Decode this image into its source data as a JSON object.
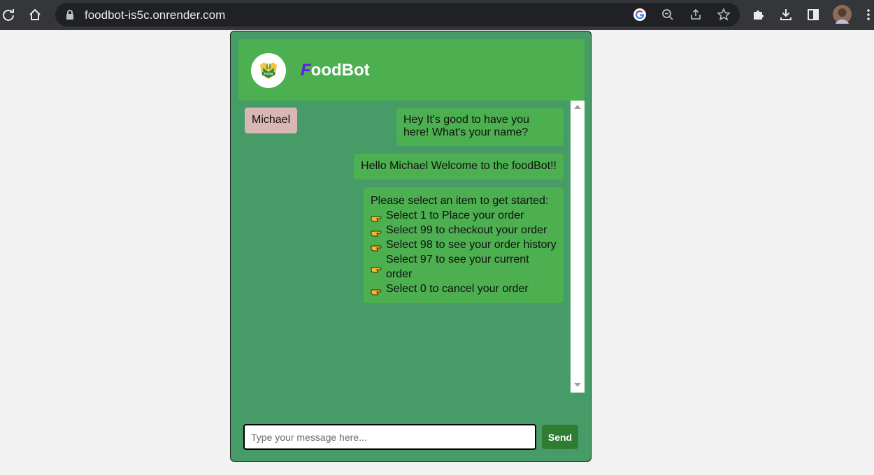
{
  "browser": {
    "url": "foodbot-is5c.onrender.com"
  },
  "chat": {
    "brand_first": "F",
    "brand_rest": "oodBot",
    "messages": {
      "user_name": "Michael",
      "bot_greeting": "Hey It's good to have you here! What's your name?",
      "bot_welcome": "Hello Michael Welcome to the foodBot!!",
      "menu_intro": "Please select an item to get started:",
      "menu_options": [
        "Select 1 to Place your order",
        "Select 99 to checkout your order",
        "Select 98 to see your order history",
        "Select 97 to see your current order",
        "Select 0 to cancel your order"
      ]
    },
    "input_placeholder": "Type your message here...",
    "send_label": "Send"
  },
  "colors": {
    "page_bg": "#f2f2f2",
    "chat_bg": "#479b66",
    "header_bg": "#4caf50",
    "bot_bubble": "#4caf50",
    "user_bubble": "#d9b7b7",
    "brand_accent": "#5a1ee6",
    "send_button": "#2e7d32"
  },
  "icons": [
    "reload-icon",
    "home-icon",
    "lock-icon",
    "google-icon",
    "zoom-icon",
    "share-icon",
    "star-icon",
    "extensions-icon",
    "download-icon",
    "side-panel-icon",
    "profile-avatar",
    "menu-icon",
    "food-logo",
    "pointing-hand-icon"
  ]
}
